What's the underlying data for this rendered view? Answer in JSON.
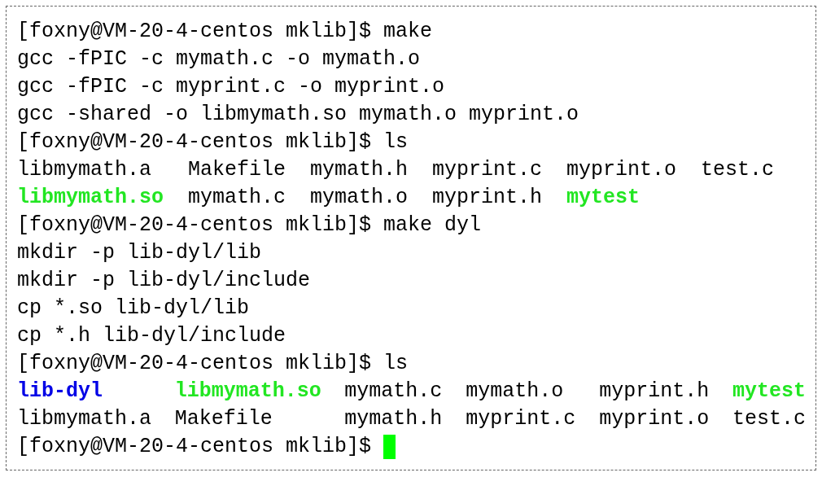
{
  "terminal": {
    "lines": [
      {
        "kind": "prompt",
        "prompt": "[foxny@VM-20-4-centos mklib]$",
        "command": "make",
        "cursor": false
      },
      {
        "kind": "output",
        "text": "gcc -fPIC -c mymath.c -o mymath.o"
      },
      {
        "kind": "output",
        "text": "gcc -fPIC -c myprint.c -o myprint.o"
      },
      {
        "kind": "output",
        "text": "gcc -shared -o libmymath.so mymath.o myprint.o"
      },
      {
        "kind": "prompt",
        "prompt": "[foxny@VM-20-4-centos mklib]$",
        "command": "ls",
        "cursor": false
      },
      {
        "kind": "listing",
        "rows": [
          [
            {
              "name": "libmymath.a",
              "kind": "file"
            },
            {
              "name": "Makefile",
              "kind": "file"
            },
            {
              "name": "mymath.h",
              "kind": "file"
            },
            {
              "name": "myprint.c",
              "kind": "file"
            },
            {
              "name": "myprint.o",
              "kind": "file"
            },
            {
              "name": "test.c",
              "kind": "file"
            }
          ],
          [
            {
              "name": "libmymath.so",
              "kind": "exec"
            },
            {
              "name": "mymath.c",
              "kind": "file"
            },
            {
              "name": "mymath.o",
              "kind": "file"
            },
            {
              "name": "myprint.h",
              "kind": "file"
            },
            {
              "name": "mytest",
              "kind": "exec"
            }
          ]
        ]
      },
      {
        "kind": "prompt",
        "prompt": "[foxny@VM-20-4-centos mklib]$",
        "command": "make dyl",
        "cursor": false
      },
      {
        "kind": "output",
        "text": "mkdir -p lib-dyl/lib"
      },
      {
        "kind": "output",
        "text": "mkdir -p lib-dyl/include"
      },
      {
        "kind": "output",
        "text": "cp *.so lib-dyl/lib"
      },
      {
        "kind": "output",
        "text": "cp *.h lib-dyl/include"
      },
      {
        "kind": "prompt",
        "prompt": "[foxny@VM-20-4-centos mklib]$",
        "command": "ls",
        "cursor": false
      },
      {
        "kind": "listing",
        "rows": [
          [
            {
              "name": "lib-dyl",
              "kind": "dir"
            },
            {
              "name": "libmymath.so",
              "kind": "exec"
            },
            {
              "name": "mymath.c",
              "kind": "file"
            },
            {
              "name": "mymath.o",
              "kind": "file"
            },
            {
              "name": "myprint.h",
              "kind": "file"
            },
            {
              "name": "mytest",
              "kind": "exec"
            }
          ],
          [
            {
              "name": "libmymath.a",
              "kind": "file"
            },
            {
              "name": "Makefile",
              "kind": "file"
            },
            {
              "name": "mymath.h",
              "kind": "file"
            },
            {
              "name": "myprint.c",
              "kind": "file"
            },
            {
              "name": "myprint.o",
              "kind": "file"
            },
            {
              "name": "test.c",
              "kind": "file"
            }
          ]
        ]
      },
      {
        "kind": "prompt",
        "prompt": "[foxny@VM-20-4-centos mklib]$",
        "cursor": true
      }
    ]
  }
}
